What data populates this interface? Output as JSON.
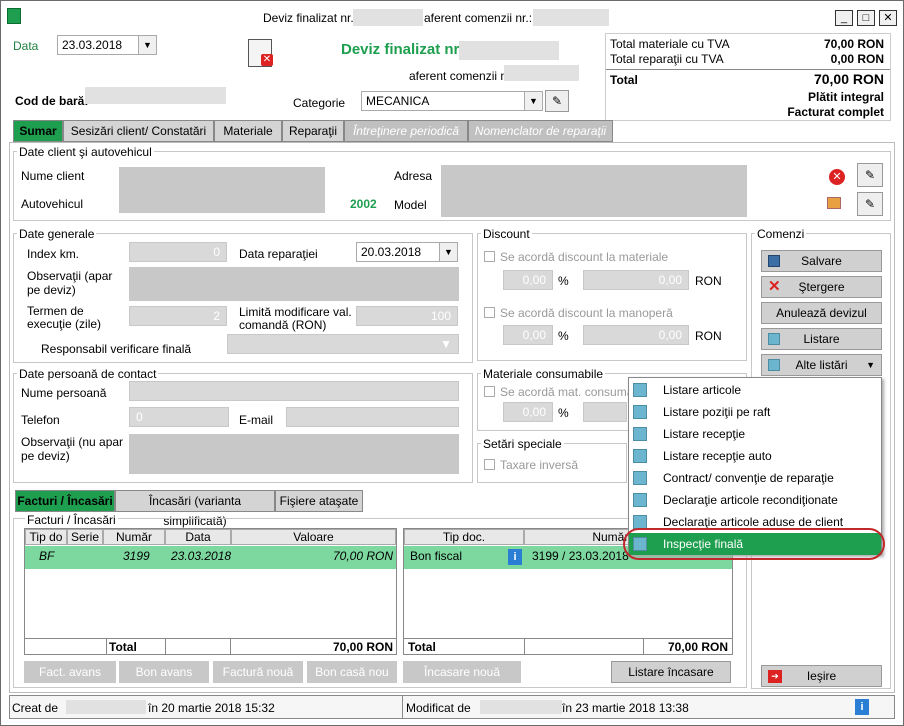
{
  "title": {
    "part1": "Deviz finalizat nr.",
    "part2": "aferent comenzii nr.:"
  },
  "header": {
    "data_label": "Data",
    "data_value": "23.03.2018",
    "doc_title": "Deviz finalizat nr.",
    "aferent_label": "aferent comenzii nr",
    "cod_bara_label": "Cod de bară:",
    "categorie_label": "Categorie",
    "categorie_value": "MECANICA"
  },
  "totals": {
    "mat_label": "Total materiale cu TVA",
    "mat_value": "70,00 RON",
    "rep_label": "Total reparaţii cu TVA",
    "rep_value": "0,00 RON",
    "total_label": "Total",
    "total_value": "70,00 RON",
    "status1": "Plătit integral",
    "status2": "Facturat complet"
  },
  "tabs": [
    "Sumar",
    "Sesizări client/ Constatări",
    "Materiale",
    "Reparaţii",
    "Întreţinere periodică",
    "Nomenclator de reparaţii"
  ],
  "client": {
    "group": "Date client şi autovehicul",
    "nume": "Nume client",
    "adresa": "Adresa",
    "auto": "Autovehicul",
    "an": "2002",
    "model": "Model"
  },
  "general": {
    "group": "Date generale",
    "index": "Index km.",
    "index_val": "0",
    "data_rep": "Data reparaţiei",
    "data_rep_val": "20.03.2018",
    "obs": "Observaţii (apar pe deviz)",
    "termen": "Termen de execuţie (zile)",
    "termen_val": "2",
    "limita": "Limită modificare val. comandă (RON)",
    "limita_val": "100",
    "resp": "Responsabil verificare finală"
  },
  "discount": {
    "group": "Discount",
    "mat": "Se acordă discount la materiale",
    "man": "Se acordă discount la manoperă",
    "pct": "0,00",
    "pct_sign": "%",
    "val": "0,00",
    "ron": "RON"
  },
  "contact": {
    "group": "Date persoană de contact",
    "nume": "Nume persoană",
    "tel": "Telefon",
    "tel_val": "0",
    "email": "E-mail",
    "obs": "Observaţii (nu apar pe deviz)"
  },
  "consum": {
    "group": "Materiale consumabile",
    "cb": "Se acordă mat. consumab",
    "pct": "0,00",
    "pct_sign": "%"
  },
  "setari": {
    "group": "Setări speciale",
    "cb": "Taxare inversă"
  },
  "comenzi": {
    "group": "Comenzi",
    "salvare": "Salvare",
    "stergere": "Ştergere",
    "anuleaza": "Anulează devizul",
    "listare": "Listare",
    "alte": "Alte listări",
    "iesire": "Ieşire"
  },
  "menu": [
    "Listare articole",
    "Listare poziţii pe raft",
    "Listare recepţie",
    "Listare recepţie auto",
    "Contract/ convenţie de reparaţie",
    "Declaraţie articole recondiţionate",
    "Declaraţie articole aduse de client",
    "Inspecţie finală"
  ],
  "bottom_tabs": [
    "Facturi / Încasări",
    "Încasări (varianta simplificată)",
    "Fişiere ataşate"
  ],
  "facturi": {
    "group": "Facturi / Încasări",
    "cols": [
      "Tip do",
      "Serie",
      "Număr",
      "Data",
      "Valoare"
    ],
    "row": {
      "tip": "BF",
      "serie": "",
      "numar": "3199",
      "data": "23.03.2018",
      "valoare": "70,00 RON"
    },
    "total_label": "Total",
    "total_value": "70,00 RON"
  },
  "incasari": {
    "cols": [
      "Tip doc.",
      "Număr / Data"
    ],
    "row": {
      "tip": "Bon fiscal",
      "nr": "3199 / 23.03.2018"
    },
    "total_label": "Total",
    "total_value": "70,00 RON"
  },
  "actions": {
    "fact_avans": "Fact. avans",
    "bon_avans": "Bon avans",
    "factura_noua": "Factură nouă",
    "bon_casa": "Bon casă nou",
    "incasare_noua": "Încasare nouă",
    "listare_incasare": "Listare încasare"
  },
  "status": {
    "creat": "Creat de",
    "creat_date": "în 20 martie 2018 15:32",
    "modificat": "Modificat de",
    "modificat_date": "în 23 martie 2018 13:38"
  }
}
